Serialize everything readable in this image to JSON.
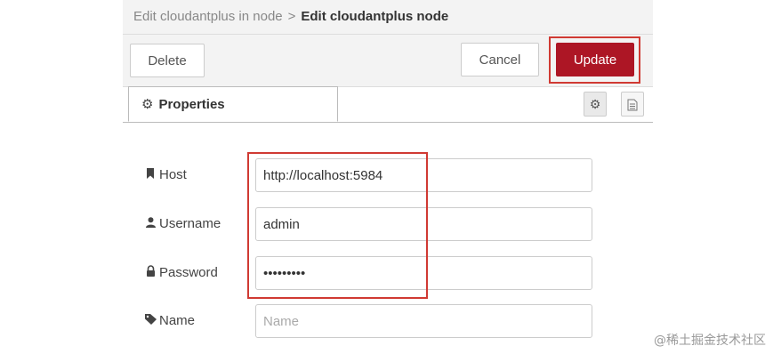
{
  "header": {
    "parent": "Edit cloudantplus in node",
    "separator": ">",
    "current": "Edit cloudantplus node"
  },
  "toolbar": {
    "delete_label": "Delete",
    "cancel_label": "Cancel",
    "update_label": "Update",
    "update_color": "#ad1625"
  },
  "tabs": {
    "properties_label": "Properties",
    "properties_icon": "gear-icon",
    "settings_icon": "gear-icon",
    "description_icon": "file-text-icon"
  },
  "form": {
    "host": {
      "label": "Host",
      "icon": "bookmark-icon",
      "value": "http://localhost:5984"
    },
    "username": {
      "label": "Username",
      "icon": "user-icon",
      "value": "admin"
    },
    "password": {
      "label": "Password",
      "icon": "lock-icon",
      "value": "•••••••••"
    },
    "name": {
      "label": "Name",
      "icon": "tag-icon",
      "value": "",
      "placeholder": "Name"
    }
  },
  "highlight_color": "#d03a33",
  "watermark": "@稀土掘金技术社区"
}
